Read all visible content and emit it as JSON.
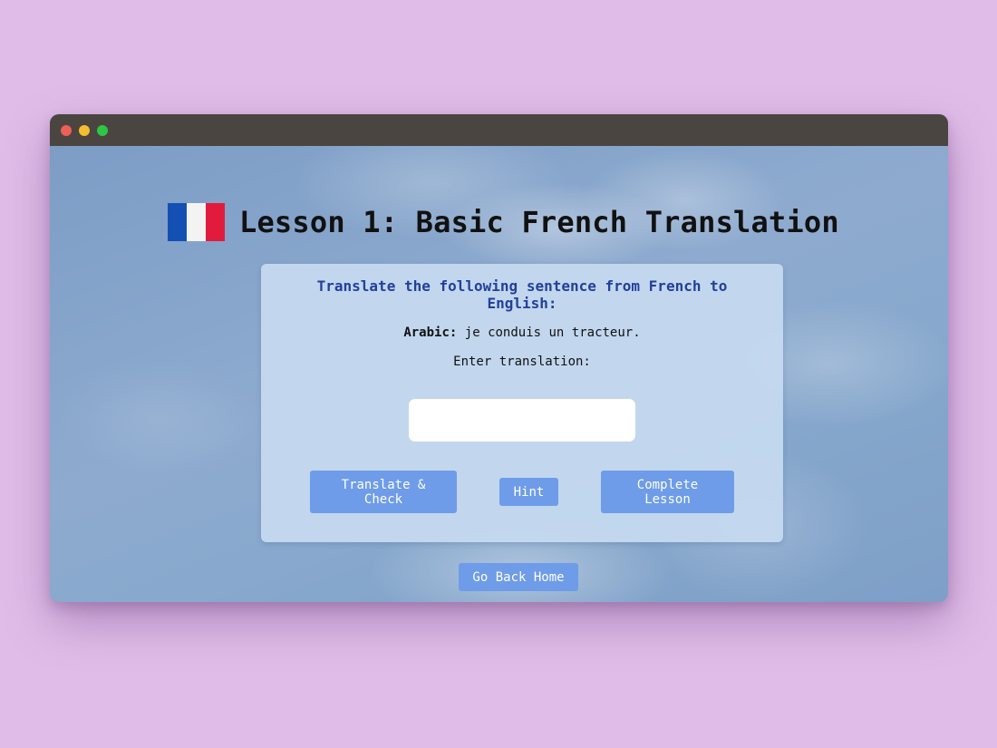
{
  "page": {
    "title": "Lesson 1: Basic French Translation",
    "flag": "france-flag",
    "colors": {
      "background": "#e0bde9",
      "titlebar": "#4a4540",
      "accent_button": "#6e9ce8",
      "instruction_text": "#22409a",
      "flag_blue": "#1450b4",
      "flag_white": "#f3f3f3",
      "flag_red": "#e21b3c"
    }
  },
  "card": {
    "instruction": "Translate the following sentence from French to English:",
    "sentence_label": "Arabic:",
    "sentence_text": "je conduis un tracteur.",
    "enter_label": "Enter translation:",
    "input_value": "",
    "input_placeholder": ""
  },
  "buttons": {
    "translate_check": "Translate & Check",
    "hint": "Hint",
    "complete_lesson": "Complete Lesson",
    "go_back_home": "Go Back Home"
  }
}
